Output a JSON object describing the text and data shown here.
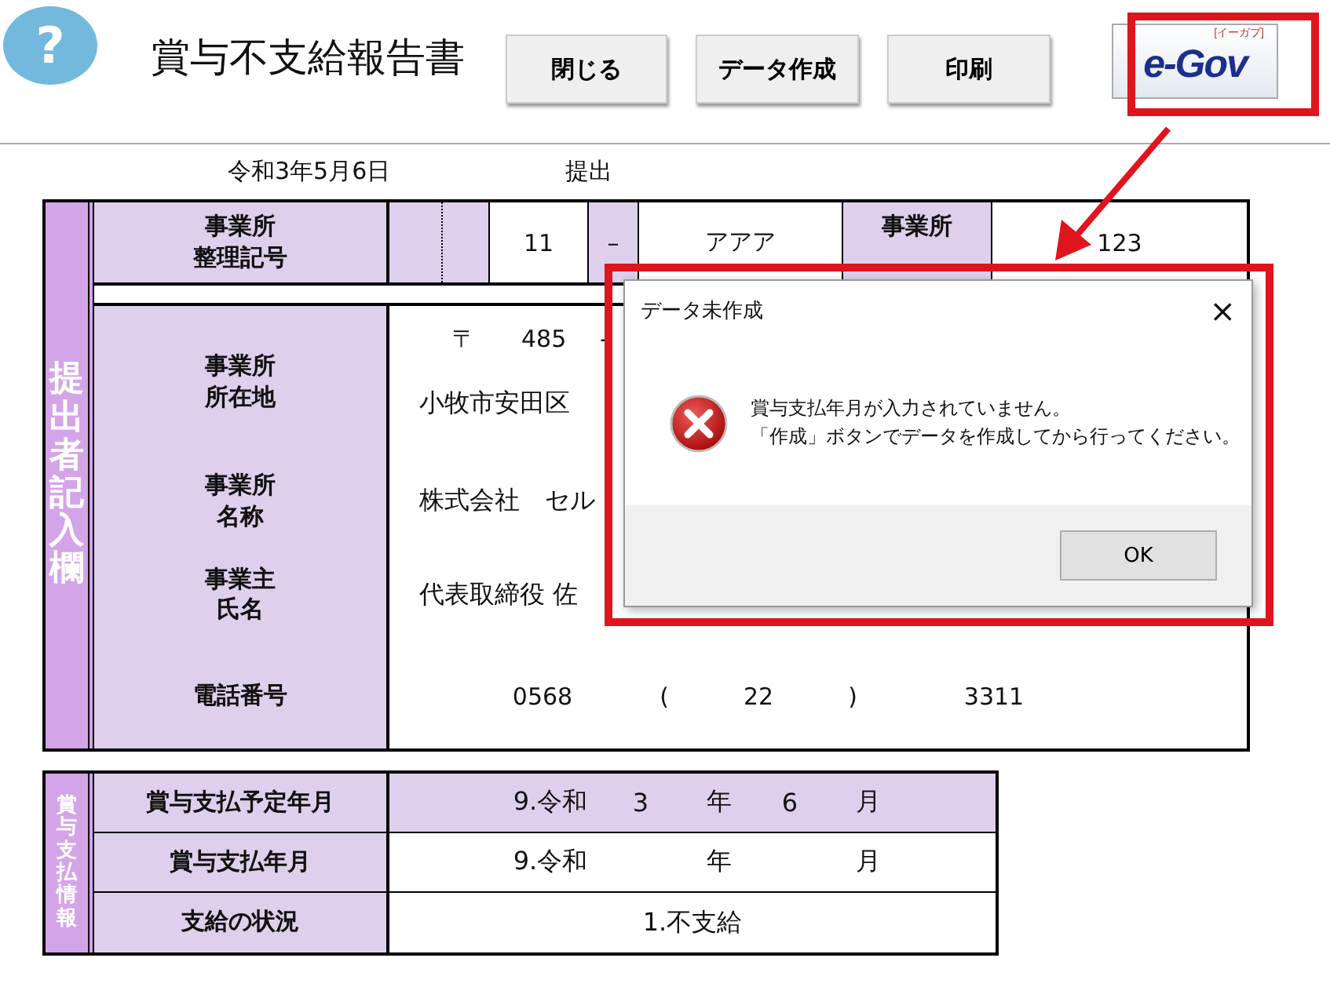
{
  "header": {
    "help": "?",
    "title": "賞与不支給報告書",
    "buttons": [
      "閉じる",
      "データ作成",
      "印刷"
    ],
    "egov": {
      "logo": "e-Gov",
      "reading": "[イーガブ]"
    }
  },
  "submission": {
    "date": "令和3年5月6日",
    "label": "提出"
  },
  "submitter": {
    "side_label": "提出者記入欄",
    "office_code": {
      "label": [
        "事業所",
        "整理記号"
      ],
      "part_1": "11",
      "separator": "–",
      "part_2": "アアア"
    },
    "office_number": {
      "label": [
        "事業所"
      ],
      "value": "123"
    },
    "address": {
      "label": [
        "事業所",
        "所在地"
      ],
      "postal_mark": "〒",
      "postal_code": "485",
      "separator": "-",
      "value": "小牧市安田区"
    },
    "name": {
      "label": [
        "事業所",
        "名称"
      ],
      "value": "株式会社　セル"
    },
    "owner": {
      "label": [
        "事業主",
        "氏名"
      ],
      "value": "代表取締役 佐"
    },
    "phone": {
      "label": [
        "電話番号"
      ],
      "area": "0568",
      "open": "(",
      "local": "22",
      "close": ")",
      "number": "3311"
    }
  },
  "payment": {
    "side_label": "賞与支払情報",
    "rows": [
      {
        "kind": "date",
        "label": "賞与支払予定年月",
        "highlighted": true,
        "era": "9.令和",
        "year": "3",
        "year_unit": "年",
        "month": "6",
        "month_unit": "月"
      },
      {
        "kind": "date",
        "label": "賞与支払年月",
        "highlighted": false,
        "era": "9.令和",
        "year_unit": "年",
        "month_unit": "月"
      },
      {
        "kind": "text",
        "label": "支給の状況",
        "highlighted": false,
        "value": "1.不支給"
      }
    ]
  },
  "dialog": {
    "title": "データ未作成",
    "close": "×",
    "lines": [
      "賞与支払年月が入力されていません。",
      "「作成」ボタンでデータを作成してから行ってください。"
    ],
    "ok": "OK"
  }
}
